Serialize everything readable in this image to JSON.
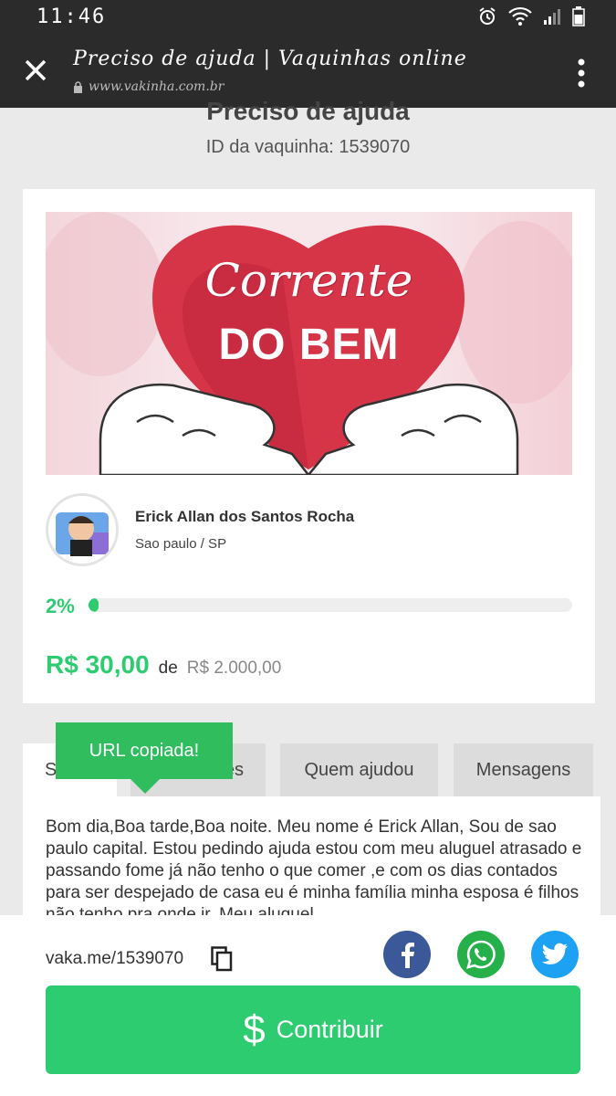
{
  "status_bar": {
    "time": "11:46"
  },
  "browser": {
    "title": "Preciso de ajuda | Vaquinhas online",
    "url": "www.vakinha.com.br"
  },
  "page": {
    "title": "Preciso de ajuda",
    "campaign_id": "ID da vaquinha: 1539070"
  },
  "campaign": {
    "image_text_line1": "Corrente",
    "image_text_line2": "DO BEM",
    "owner_name": "Erick Allan dos Santos Rocha",
    "owner_location": "Sao paulo / SP",
    "progress_label": "2%",
    "progress_fraction": 0.02,
    "raised": "R$ 30,00",
    "of_label": "de",
    "goal": "R$ 2.000,00"
  },
  "tabs": [
    {
      "label": "S"
    },
    {
      "label": "es"
    },
    {
      "label": "Quem ajudou"
    },
    {
      "label": "Mensagens"
    }
  ],
  "tooltip": {
    "text": "URL copiada!"
  },
  "description": "Bom dia,Boa tarde,Boa noite. Meu nome é Erick Allan, Sou de sao paulo capital. Estou pedindo ajuda estou com meu aluguel atrasado e passando fome já não tenho o que comer ,e com os dias contados para ser despejado de casa eu é minha família minha esposa é filhos não tenho pra onde ir. Meu aluguel",
  "bottom_bar": {
    "short_url": "vaka.me/1539070",
    "contribute_label": "Contribuir",
    "contribute_symbol": "$",
    "social_icons": [
      "facebook-icon",
      "whatsapp-icon",
      "twitter-icon"
    ]
  },
  "colors": {
    "accent_green": "#2ecc71",
    "tooltip_green": "#2fbd5d",
    "facebook": "#3b5998",
    "whatsapp": "#25b04a",
    "twitter": "#1da1f2"
  }
}
